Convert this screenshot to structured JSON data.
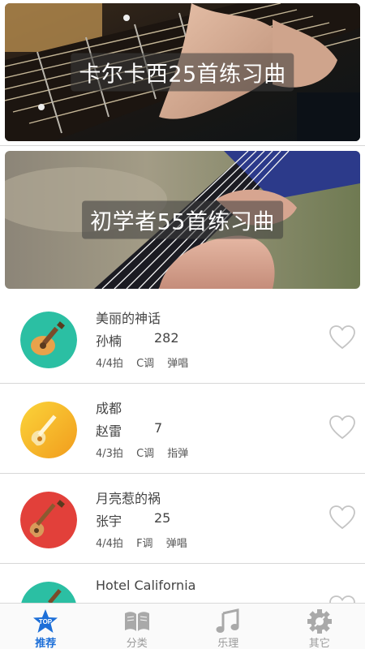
{
  "banners": [
    {
      "title": "卡尔卡西25首练习曲"
    },
    {
      "title": "初学者55首练习曲"
    }
  ],
  "songs": [
    {
      "title": "美丽的神话",
      "artist": "孙楠",
      "count": "282",
      "time_sig": "4/4拍",
      "key": "C调",
      "style": "弹唱",
      "avatar_color": "#2bbfa3"
    },
    {
      "title": "成都",
      "artist": "赵雷",
      "count": "7",
      "time_sig": "4/3拍",
      "key": "C调",
      "style": "指弹",
      "avatar_color": "#f7b524"
    },
    {
      "title": "月亮惹的祸",
      "artist": "张宇",
      "count": "25",
      "time_sig": "4/4拍",
      "key": "F调",
      "style": "弹唱",
      "avatar_color": "#e2403a"
    },
    {
      "title": "Hotel California",
      "artist": "",
      "count": "",
      "time_sig": "",
      "key": "",
      "style": "",
      "avatar_color": "#2bbfa3"
    }
  ],
  "tabbar": {
    "items": [
      {
        "label": "推荐",
        "icon": "top-star-icon",
        "active": true
      },
      {
        "label": "分类",
        "icon": "book-icon",
        "active": false
      },
      {
        "label": "乐理",
        "icon": "music-note-icon",
        "active": false
      },
      {
        "label": "其它",
        "icon": "gear-icon",
        "active": false
      }
    ],
    "top_badge": "TOP"
  },
  "colors": {
    "accent": "#1d6fd8",
    "inactive": "#9a9a9a"
  }
}
